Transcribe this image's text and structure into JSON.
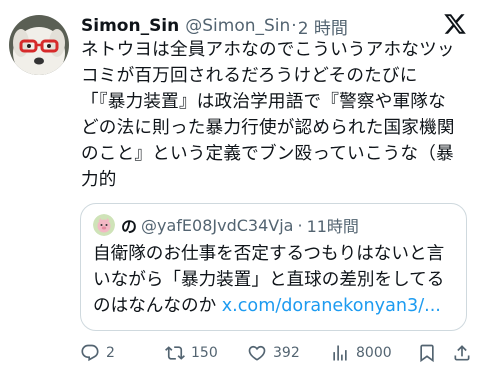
{
  "tweet": {
    "author_name": "Simon_Sin",
    "handle": "@Simon_Sin",
    "separator": "·",
    "time": "2 時間",
    "text_lines": [
      "ネトウヨは全員アホなのでこういうアホなツッ",
      "コミが百万回されるだろうけどそのたびに",
      "「『暴力装置』は政治学用語で『警察や軍隊な",
      "どの法に則った暴力行使が認められた国家機関",
      "のこと』という定義でブン殴っていこうな（暴",
      "力的"
    ]
  },
  "quote": {
    "author_name": "の",
    "handle": "@yafE08JvdC34Vja",
    "separator": "·",
    "time": "11時間",
    "text_lines": [
      "自衛隊のお仕事を否定するつもりはないと言",
      "いながら「暴力装置」と直球の差別をしてる",
      "のはなんなのか "
    ],
    "link": "x.com/doranekonyan3/..."
  },
  "actions": {
    "reply_count": "2",
    "retweet_count": "150",
    "like_count": "392",
    "view_count": "8000"
  },
  "icons": {
    "brand": "x-logo-icon",
    "reply": "reply-icon",
    "retweet": "retweet-icon",
    "like": "heart-icon",
    "views": "views-icon",
    "bookmark": "bookmark-icon",
    "share": "share-icon"
  },
  "colors": {
    "text": "#0f1419",
    "secondary": "#536471",
    "link": "#1d9bf0",
    "border": "#cfd9de"
  }
}
